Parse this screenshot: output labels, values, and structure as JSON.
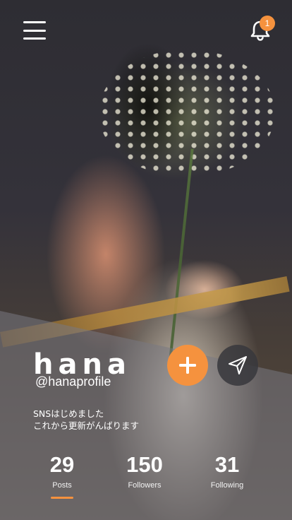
{
  "header": {
    "notification_count": "1"
  },
  "profile": {
    "name": "hana",
    "handle": "@hanaprofile",
    "bio_lines": [
      "SNSはじめました",
      "これから更新がんばります"
    ]
  },
  "stats": [
    {
      "value": "29",
      "label": "Posts"
    },
    {
      "value": "150",
      "label": "Followers"
    },
    {
      "value": "31",
      "label": "Following"
    }
  ],
  "active_tab": "Posts",
  "colors": {
    "accent": "#f5923e",
    "text": "#ffffff",
    "panel": "#78788280"
  },
  "icons": {
    "menu": "hamburger-menu-icon",
    "notifications": "bell-icon",
    "follow": "plus-icon",
    "message": "send-icon"
  }
}
